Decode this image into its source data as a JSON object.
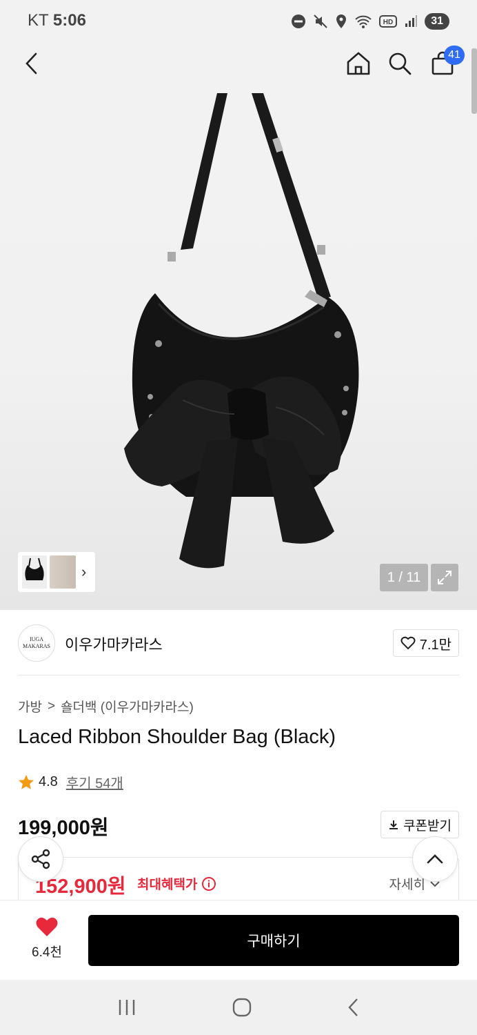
{
  "status_bar": {
    "carrier": "KT",
    "time": "5:06",
    "battery": "31"
  },
  "header": {
    "cart_count": "41"
  },
  "gallery": {
    "counter": "1 / 11"
  },
  "brand": {
    "logo_line1": "IUGA",
    "logo_line2": "MAKARAS",
    "name": "이우가마카라스",
    "likes": "7.1만"
  },
  "breadcrumb": {
    "category": "가방",
    "separator": ">",
    "subcategory": "숄더백 (이우가마카라스)"
  },
  "product": {
    "title": "Laced Ribbon Shoulder Bag (Black)",
    "rating": "4.8",
    "reviews": "후기 54개",
    "price": "199,000원",
    "coupon_label": "쿠폰받기",
    "benefit_price": "152,900원",
    "benefit_label": "최대혜택가",
    "benefit_more": "자세히"
  },
  "buy_bar": {
    "wish_count": "6.4천",
    "buy_label": "구매하기"
  },
  "colors": {
    "accent_red": "#e8283b",
    "badge_blue": "#2f6cf6",
    "buy_button": "#000000",
    "star": "#f29a12"
  }
}
